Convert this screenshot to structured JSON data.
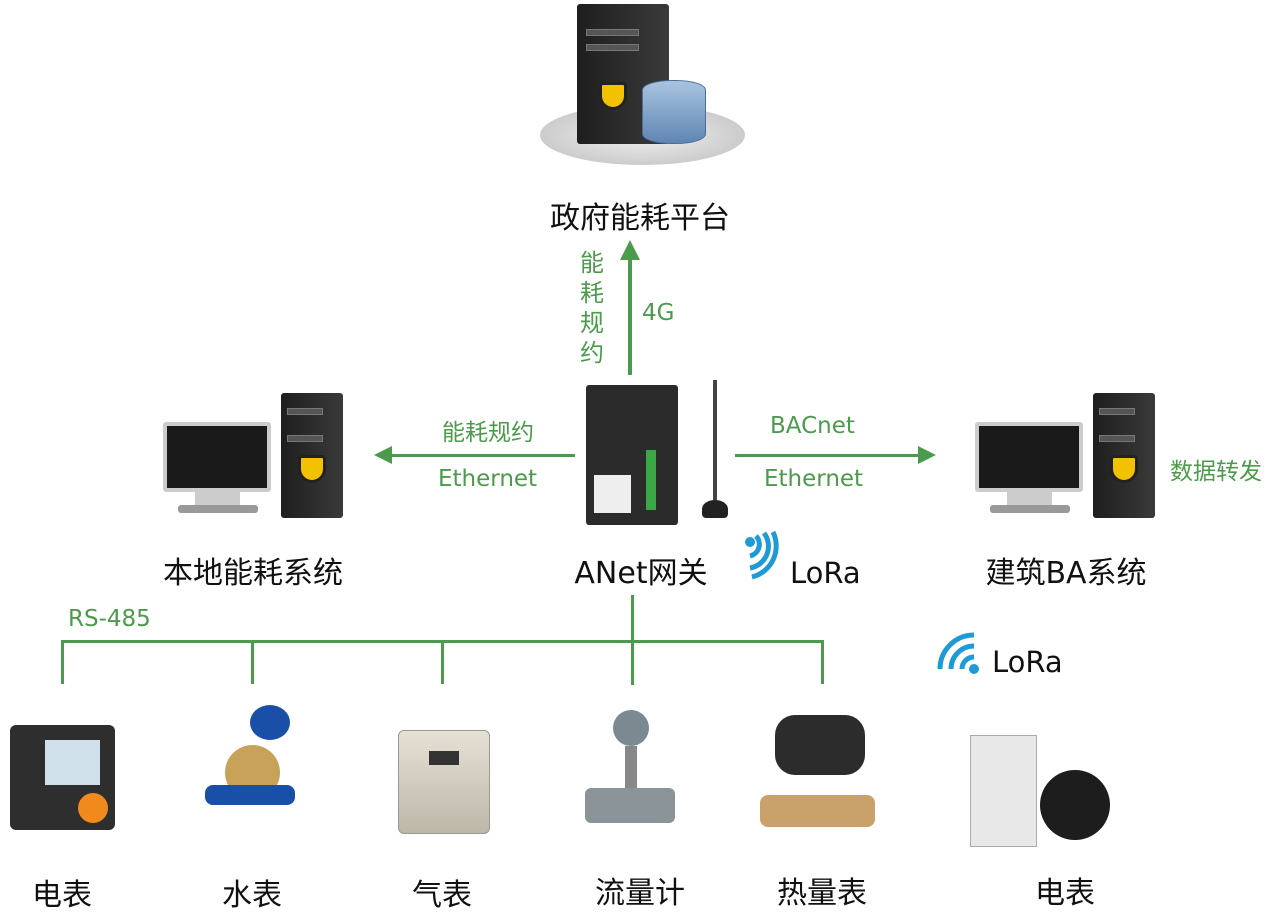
{
  "colors": {
    "accent": "#4c9a4c",
    "lora": "#1e9ad6"
  },
  "top": {
    "label": "政府能耗平台",
    "protocol_vertical": [
      "能",
      "耗",
      "规",
      "约"
    ],
    "link": "4G"
  },
  "left": {
    "label": "本地能耗系统",
    "protocol": "能耗规约",
    "link": "Ethernet"
  },
  "center": {
    "label": "ANet网关",
    "lora": "LoRa"
  },
  "right": {
    "label": "建筑BA系统",
    "protocol": "BACnet",
    "link": "Ethernet",
    "note": "数据转发"
  },
  "bus": {
    "label": "RS-485"
  },
  "wireless": {
    "label": "LoRa"
  },
  "devices": [
    {
      "label": "电表",
      "icon": "power-meter-icon"
    },
    {
      "label": "水表",
      "icon": "water-meter-icon"
    },
    {
      "label": "气表",
      "icon": "gas-meter-icon"
    },
    {
      "label": "流量计",
      "icon": "flow-meter-icon"
    },
    {
      "label": "热量表",
      "icon": "heat-meter-icon"
    },
    {
      "label": "电表",
      "icon": "lora-power-meter-icon"
    }
  ]
}
